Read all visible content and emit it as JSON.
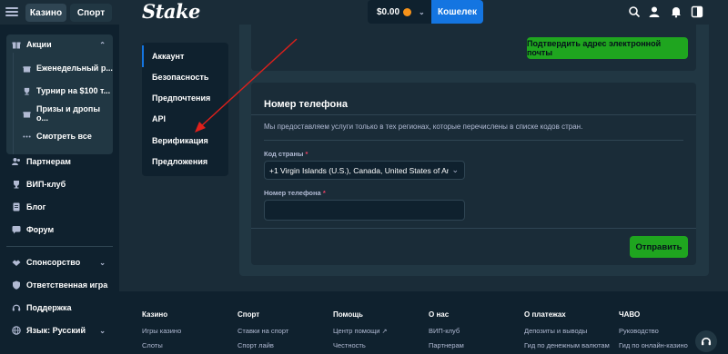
{
  "topbar": {
    "tab_casino": "Казино",
    "tab_sport": "Спорт",
    "logo": "Stake",
    "balance": "$0.00",
    "wallet_button": "Кошелек",
    "icons": [
      "search-icon",
      "user-icon",
      "bell-icon",
      "sidebar-toggle-icon"
    ]
  },
  "sidebar": {
    "promotions": "Акции",
    "promo_items": [
      "Еженедельный р...",
      "Турнир на $100 т...",
      "Призы и дропы о...",
      "Смотреть все"
    ],
    "items": [
      "Партнерам",
      "ВИП-клуб",
      "Блог",
      "Форум"
    ],
    "sponsorship": "Спонсорство",
    "responsible": "Ответственная игра",
    "support": "Поддержка",
    "language": "Язык: Русский"
  },
  "settings_menu": {
    "items": [
      "Аккаунт",
      "Безопасность",
      "Предпочтения",
      "API",
      "Верификация",
      "Предложения"
    ],
    "active": "Аккаунт"
  },
  "email": {
    "confirm_button": "Подтвердить адрес электронной почты"
  },
  "phone": {
    "title": "Номер телефона",
    "description": "Мы предоставляем услуги только в тех регионах, которые перечислены в списке кодов стран.",
    "country_label": "Код страны",
    "country_value": "+1 Virgin Islands (U.S.), Canada, United States of Ame",
    "phone_label": "Номер телефона",
    "phone_value": "",
    "required_mark": "*",
    "submit_button": "Отправить"
  },
  "footer": {
    "columns": [
      {
        "title": "Казино",
        "links": [
          "Игры казино",
          "Слоты"
        ]
      },
      {
        "title": "Спорт",
        "links": [
          "Ставки на спорт",
          "Спорт лайв"
        ]
      },
      {
        "title": "Помощь",
        "links": [
          "Центр помощи",
          "Честность"
        ]
      },
      {
        "title": "О нас",
        "links": [
          "ВИП-клуб",
          "Партнерам"
        ]
      },
      {
        "title": "О платежах",
        "links": [
          "Депозиты и выводы",
          "Гид по денежным валютам"
        ]
      },
      {
        "title": "ЧАВО",
        "links": [
          "Руководство",
          "Гид по онлайн-казино"
        ]
      }
    ]
  },
  "colors": {
    "bg": "#1a2c38",
    "sidebar": "#0f212e",
    "accent_blue": "#1475e1",
    "accent_green": "#1fa51f",
    "annotation_red": "#e0201b"
  }
}
